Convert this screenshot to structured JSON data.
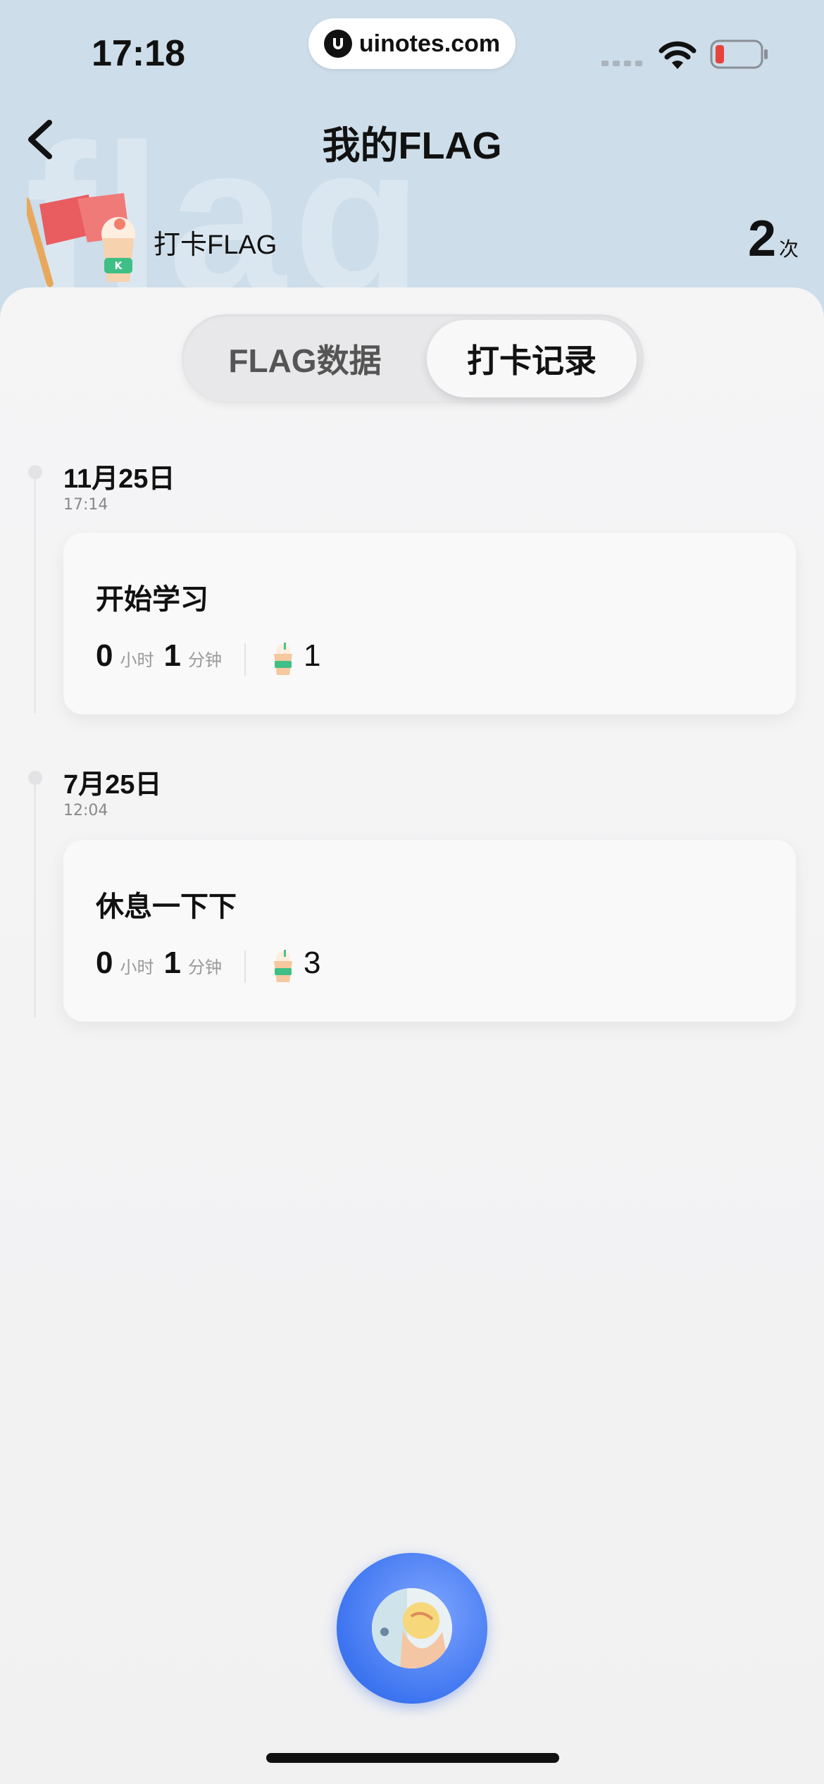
{
  "status_bar": {
    "time": "17:18",
    "url": "uinotes.com"
  },
  "nav": {
    "title": "我的FLAG",
    "back_icon": "chevron-left-icon"
  },
  "summary": {
    "label": "打卡FLAG",
    "count": "2",
    "count_unit": "次",
    "watermark": "flag"
  },
  "tabs": [
    {
      "label": "FLAG数据",
      "active": false
    },
    {
      "label": "打卡记录",
      "active": true
    }
  ],
  "records": [
    {
      "date": "11月25日",
      "time": "17:14",
      "name": "开始学习",
      "hours": "0",
      "hours_unit": "小时",
      "minutes": "1",
      "minutes_unit": "分钟",
      "cups": "1"
    },
    {
      "date": "7月25日",
      "time": "12:04",
      "name": "休息一下下",
      "hours": "0",
      "hours_unit": "小时",
      "minutes": "1",
      "minutes_unit": "分钟",
      "cups": "3"
    }
  ],
  "colors": {
    "header_bg": "#cddde9",
    "fab_blue": "#3d74f0",
    "panel_bg": "#f3f3f4"
  }
}
